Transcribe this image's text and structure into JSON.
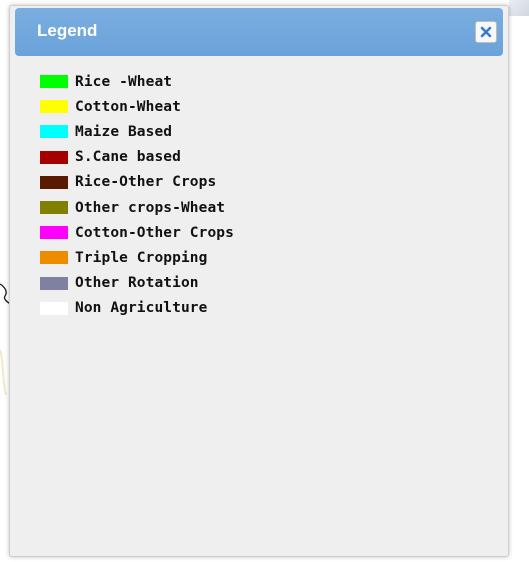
{
  "window": {
    "title": "Legend",
    "close_icon": "close-icon"
  },
  "legend": {
    "items": [
      {
        "label": "Rice -Wheat",
        "color": "#00ff00"
      },
      {
        "label": "Cotton-Wheat",
        "color": "#ffff00"
      },
      {
        "label": "Maize Based",
        "color": "#00ffff"
      },
      {
        "label": "S.Cane based",
        "color": "#a50000"
      },
      {
        "label": "Rice-Other Crops",
        "color": "#5a1a00"
      },
      {
        "label": "Other crops-Wheat",
        "color": "#808000"
      },
      {
        "label": "Cotton-Other Crops",
        "color": "#ff00ff"
      },
      {
        "label": "Triple Cropping",
        "color": "#ee8c00"
      },
      {
        "label": "Other Rotation",
        "color": "#8080a0"
      },
      {
        "label": "Non Agriculture",
        "color": "#ffffff"
      }
    ]
  },
  "colors": {
    "title_bar": "#6aa2da",
    "panel_background": "#efefef",
    "close_icon": "#3a78d0"
  }
}
